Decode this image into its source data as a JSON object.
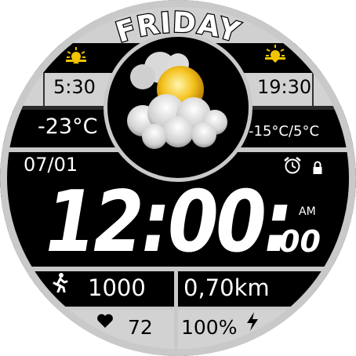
{
  "day": "FRIDAY",
  "sun": {
    "sunrise": "5:30",
    "sunset": "19:30",
    "sunrise_icon": "sunrise-icon",
    "sunset_icon": "sunset-icon"
  },
  "weather": {
    "current_temp": "-23°C",
    "range": "-15°C/5°C",
    "icon": "partly-cloudy-icon"
  },
  "date": "07/01",
  "status_icons": [
    "alarm-clock-icon",
    "lock-icon"
  ],
  "time": {
    "hm": "12:00:",
    "seconds": "00",
    "ampm": "AM"
  },
  "activity": {
    "steps": "1000",
    "distance": "0,70km",
    "heart_rate": "72",
    "battery": "100%",
    "steps_icon": "walking-icon",
    "heart_icon": "heart-icon",
    "battery_icon": "lightning-icon"
  },
  "colors": {
    "bezel": "#c9c9c9",
    "panel_gray": "#d2d2d2",
    "divider_dark": "#262626",
    "accent_green": "#2fa62f",
    "accent_yellow": "#f2c400",
    "accent_red": "#d63a1f"
  }
}
